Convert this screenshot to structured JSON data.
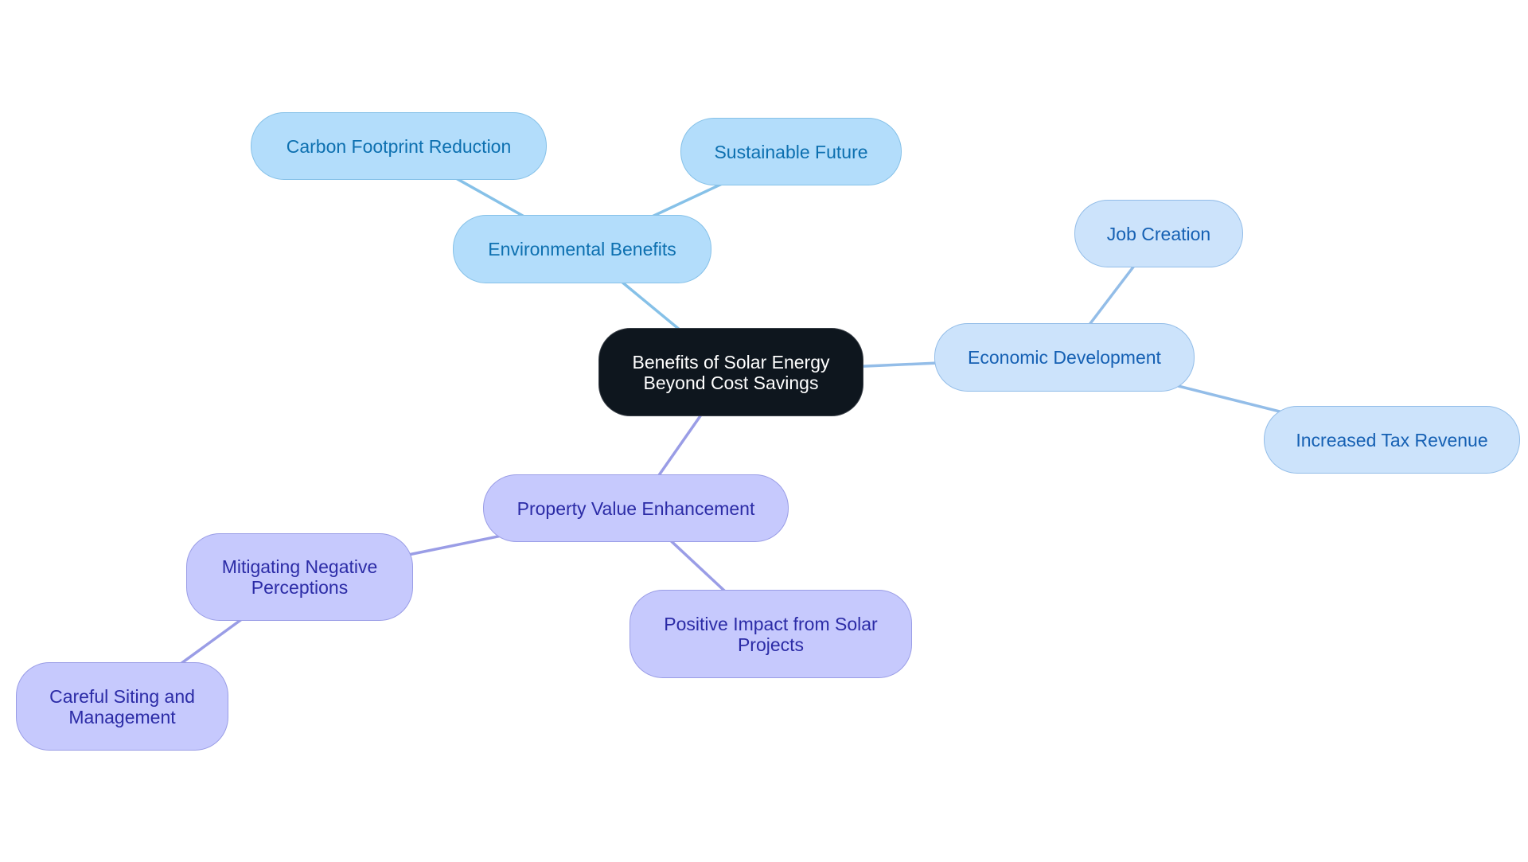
{
  "title": "Benefits of Solar Energy Beyond Cost Savings",
  "colors": {
    "root_fill": "#0e161e",
    "environmental_fill": "#b3ddfb",
    "environmental_edge": "#86c1e8",
    "economic_fill": "#cce3fb",
    "economic_edge": "#93bde8",
    "property_fill": "#c6c9fd",
    "property_edge": "#9a9de6"
  },
  "nodes": {
    "root": {
      "label": "Benefits of Solar Energy\nBeyond Cost Savings"
    },
    "environmental": {
      "label": "Environmental Benefits"
    },
    "carbon": {
      "label": "Carbon Footprint Reduction"
    },
    "sustainable": {
      "label": "Sustainable Future"
    },
    "economic": {
      "label": "Economic Development"
    },
    "jobs": {
      "label": "Job Creation"
    },
    "tax": {
      "label": "Increased Tax Revenue"
    },
    "property": {
      "label": "Property Value Enhancement"
    },
    "mitigating": {
      "label": "Mitigating Negative\nPerceptions"
    },
    "positive": {
      "label": "Positive Impact from Solar\nProjects"
    },
    "careful": {
      "label": "Careful Siting and\nManagement"
    }
  },
  "edges": [
    {
      "from": "root",
      "to": "environmental",
      "branch": "environmental"
    },
    {
      "from": "environmental",
      "to": "carbon",
      "branch": "environmental"
    },
    {
      "from": "environmental",
      "to": "sustainable",
      "branch": "environmental"
    },
    {
      "from": "root",
      "to": "economic",
      "branch": "economic"
    },
    {
      "from": "economic",
      "to": "jobs",
      "branch": "economic"
    },
    {
      "from": "economic",
      "to": "tax",
      "branch": "economic"
    },
    {
      "from": "root",
      "to": "property",
      "branch": "property"
    },
    {
      "from": "property",
      "to": "mitigating",
      "branch": "property"
    },
    {
      "from": "property",
      "to": "positive",
      "branch": "property"
    },
    {
      "from": "mitigating",
      "to": "careful",
      "branch": "property"
    }
  ]
}
